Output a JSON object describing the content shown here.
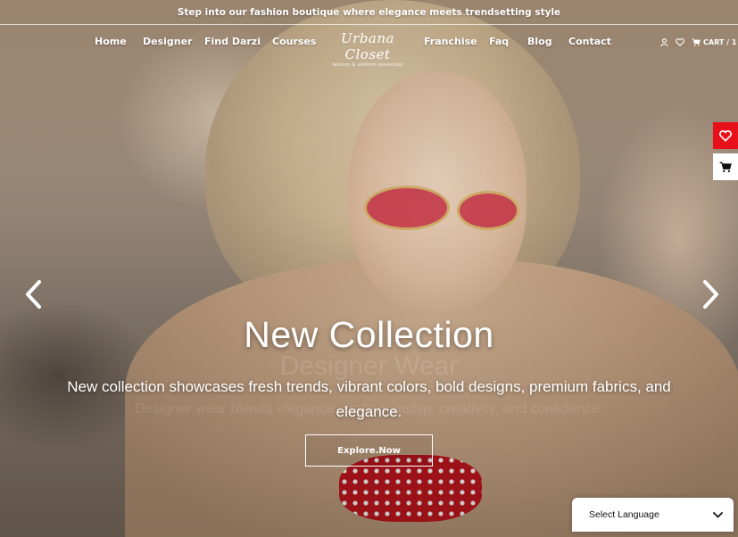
{
  "announcement": "Step into our fashion boutique where elegance meets trendsetting style",
  "nav": {
    "items": [
      "Home",
      "Designer",
      "Find Darzi",
      "Courses",
      "Franchise",
      "Faq",
      "Blog",
      "Contact"
    ],
    "logo_script": "Urbana Closet",
    "logo_tagline": "fashion & uniform essentials",
    "cart_label": "CART / 1"
  },
  "hero": {
    "title": "New Collection",
    "subtitle": "New collection showcases fresh trends, vibrant colors, bold designs, premium fabrics, and elegance.",
    "ghost_title": "Designer Wear",
    "ghost_subtitle": "Designer wear blends elegance, craftsmanship, creativity, and confidence.",
    "button_label": "Explore.Now"
  },
  "language": {
    "selected": "Select Language"
  },
  "colors": {
    "wishlist_red": "#e8111b",
    "white": "#ffffff"
  },
  "icons": [
    "user-icon",
    "heart-icon",
    "cart-icon",
    "chevron-left-icon",
    "chevron-right-icon",
    "chevron-down-icon"
  ]
}
